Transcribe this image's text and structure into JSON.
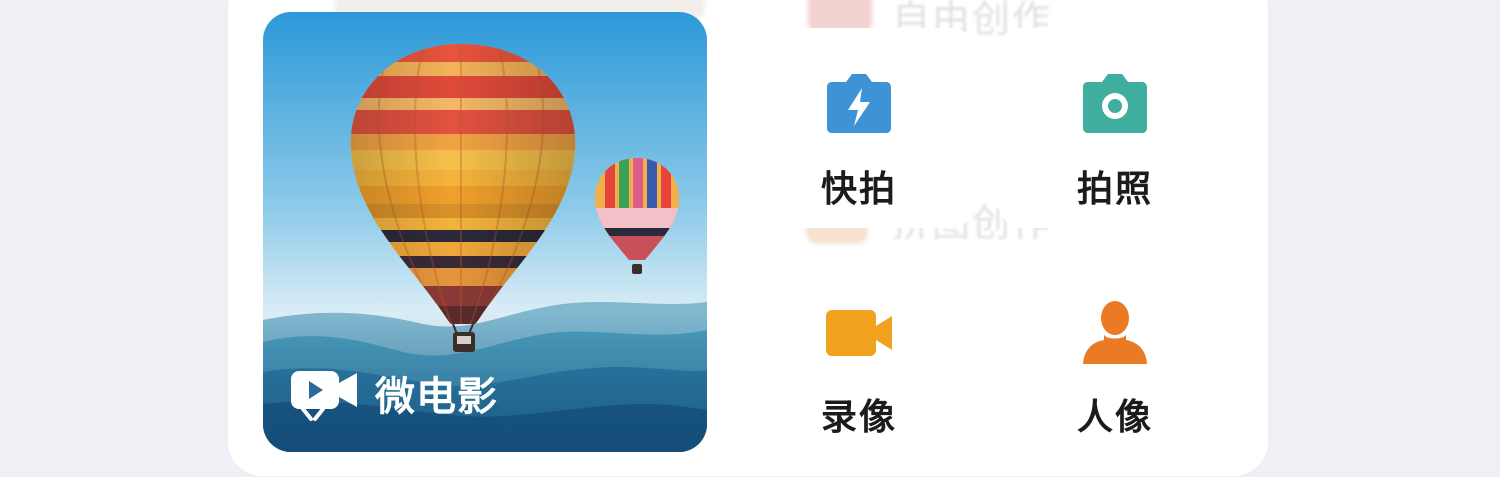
{
  "background_items": [
    {
      "label": "自由创作"
    },
    {
      "label": "拼图创作"
    }
  ],
  "featured": {
    "label": "微电影",
    "icon": "video-camera-icon"
  },
  "shortcuts": [
    {
      "id": "quick-shot",
      "label": "快拍",
      "icon": "lightning-camera-icon",
      "color": "#3d93d6"
    },
    {
      "id": "photo",
      "label": "拍照",
      "icon": "camera-icon",
      "color": "#3fae9f"
    },
    {
      "id": "record",
      "label": "录像",
      "icon": "video-camera-icon",
      "color": "#f0a21e"
    },
    {
      "id": "portrait",
      "label": "人像",
      "icon": "person-icon",
      "color": "#ea7a24"
    }
  ],
  "colors": {
    "page_background": "#eef0f5",
    "panel": "#ffffff",
    "sky_top": "#2f9ad8",
    "sky_bottom": "#e9f3f8"
  }
}
